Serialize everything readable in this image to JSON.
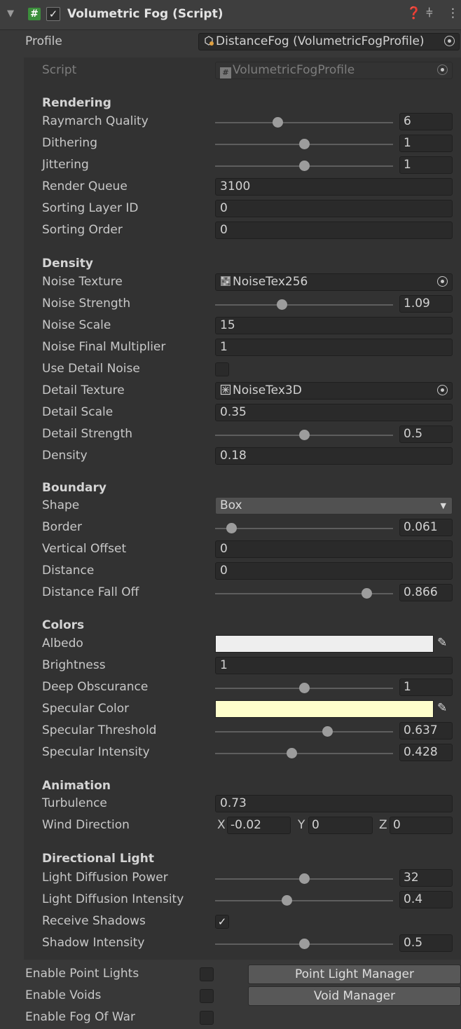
{
  "header": {
    "title": "Volumetric Fog (Script)",
    "enabled": true
  },
  "profile": {
    "label": "Profile",
    "value": "DistanceFog (VolumetricFogProfile)"
  },
  "script": {
    "label": "Script",
    "value": "VolumetricFogProfile"
  },
  "sections": {
    "rendering": "Rendering",
    "density": "Density",
    "boundary": "Boundary",
    "colors": "Colors",
    "animation": "Animation",
    "directional_light": "Directional Light"
  },
  "rendering": {
    "raymarch_quality": {
      "label": "Raymarch Quality",
      "value": "6",
      "fraction": 0.35
    },
    "dithering": {
      "label": "Dithering",
      "value": "1",
      "fraction": 0.5
    },
    "jittering": {
      "label": "Jittering",
      "value": "1",
      "fraction": 0.5
    },
    "render_queue": {
      "label": "Render Queue",
      "value": "3100"
    },
    "sorting_layer_id": {
      "label": "Sorting Layer ID",
      "value": "0"
    },
    "sorting_order": {
      "label": "Sorting Order",
      "value": "0"
    }
  },
  "density": {
    "noise_texture": {
      "label": "Noise Texture",
      "value": "NoiseTex256"
    },
    "noise_strength": {
      "label": "Noise Strength",
      "value": "1.09",
      "fraction": 0.375
    },
    "noise_scale": {
      "label": "Noise Scale",
      "value": "15"
    },
    "noise_final_multiplier": {
      "label": "Noise Final Multiplier",
      "value": "1"
    },
    "use_detail_noise": {
      "label": "Use Detail Noise",
      "checked": false
    },
    "detail_texture": {
      "label": "Detail Texture",
      "value": "NoiseTex3D"
    },
    "detail_scale": {
      "label": "Detail Scale",
      "value": "0.35"
    },
    "detail_strength": {
      "label": "Detail Strength",
      "value": "0.5",
      "fraction": 0.5
    },
    "density": {
      "label": "Density",
      "value": "0.18"
    }
  },
  "boundary": {
    "shape": {
      "label": "Shape",
      "value": "Box"
    },
    "border": {
      "label": "Border",
      "value": "0.061",
      "fraction": 0.09
    },
    "vertical_offset": {
      "label": "Vertical Offset",
      "value": "0"
    },
    "distance": {
      "label": "Distance",
      "value": "0"
    },
    "distance_fall_off": {
      "label": "Distance Fall Off",
      "value": "0.866",
      "fraction": 0.85
    }
  },
  "colors": {
    "albedo": {
      "label": "Albedo",
      "color": "#eeeeee"
    },
    "brightness": {
      "label": "Brightness",
      "value": "1"
    },
    "deep_obscurance": {
      "label": "Deep Obscurance",
      "value": "1",
      "fraction": 0.5
    },
    "specular_color": {
      "label": "Specular Color",
      "color": "#ffffcc"
    },
    "specular_threshold": {
      "label": "Specular Threshold",
      "value": "0.637",
      "fraction": 0.63
    },
    "specular_intensity": {
      "label": "Specular Intensity",
      "value": "0.428",
      "fraction": 0.43
    }
  },
  "animation": {
    "turbulence": {
      "label": "Turbulence",
      "value": "0.73"
    },
    "wind_direction": {
      "label": "Wind Direction",
      "x_label": "X",
      "x": "-0.02",
      "y_label": "Y",
      "y": "0",
      "z_label": "Z",
      "z": "0"
    }
  },
  "directional_light": {
    "light_diffusion_power": {
      "label": "Light Diffusion Power",
      "value": "32",
      "fraction": 0.5
    },
    "light_diffusion_intensity": {
      "label": "Light Diffusion Intensity",
      "value": "0.4",
      "fraction": 0.4
    },
    "receive_shadows": {
      "label": "Receive Shadows",
      "checked": true
    },
    "shadow_intensity": {
      "label": "Shadow Intensity",
      "value": "0.5",
      "fraction": 0.5
    }
  },
  "bottom": {
    "enable_point_lights": {
      "label": "Enable Point Lights",
      "button": "Point Light Manager"
    },
    "enable_voids": {
      "label": "Enable Voids",
      "button": "Void Manager"
    },
    "enable_fog_of_war": {
      "label": "Enable Fog Of War"
    }
  }
}
